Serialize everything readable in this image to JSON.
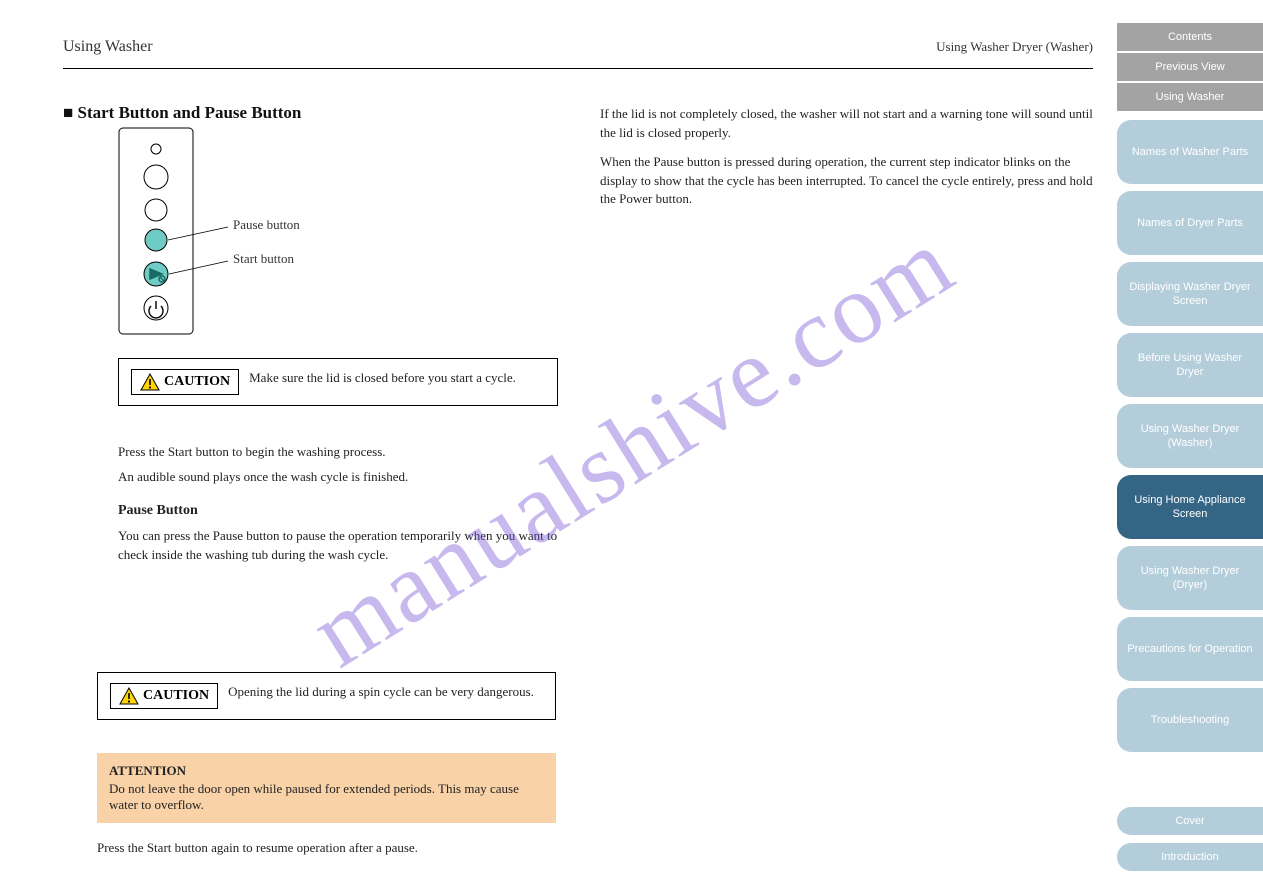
{
  "header": {
    "left": "Using Washer",
    "right": "Using Washer Dryer (Washer)"
  },
  "section": {
    "heading": "■ Start Button and Pause Button"
  },
  "remote": {
    "labels": {
      "pause": "Pause button",
      "start": "Start button"
    }
  },
  "caution1": "Make sure the lid is closed before you start a cycle.",
  "afterCaution1": {
    "p1": "Press the Start button to begin the washing process.",
    "p2": "An audible sound plays once the wash cycle is finished.",
    "h1": "Pause Button",
    "p3": "You can press the Pause button to pause the operation temporarily when you want to check inside the washing tub during the wash cycle."
  },
  "caution2": "Opening the lid during a spin cycle can be very dangerous.",
  "attention": {
    "title": "ATTENTION",
    "body": "Do not leave the door open while paused for extended periods. This may cause water to overflow."
  },
  "finalLine": "Press the Start button again to resume operation after a pause.",
  "rightCol": {
    "p1": "If the lid is not completely closed, the washer will not start and a warning tone will sound until the lid is closed properly.",
    "p2": "When the Pause button is pressed during operation, the current step indicator blinks on the display to show that the cycle has been interrupted. To cancel the cycle entirely, press and hold the Power button."
  },
  "nav": {
    "top": [
      "Contents",
      "Previous View",
      "Using Washer"
    ],
    "sections": [
      {
        "label": "Names of Washer Parts",
        "active": false
      },
      {
        "label": "Names of Dryer Parts",
        "active": false
      },
      {
        "label": "Displaying Washer Dryer Screen",
        "active": false
      },
      {
        "label": "Before Using Washer Dryer",
        "active": false
      },
      {
        "label": "Using Washer Dryer (Washer)",
        "active": false
      },
      {
        "label": "Using Home Appliance Screen",
        "active": true
      },
      {
        "label": "Using Washer Dryer (Dryer)",
        "active": false
      },
      {
        "label": "Precautions for Operation",
        "active": false
      },
      {
        "label": "Troubleshooting",
        "active": false
      }
    ],
    "bottom": [
      "Cover",
      "Introduction"
    ]
  },
  "watermark": "manualshive.com",
  "icons": {
    "caution": "caution-triangle-icon"
  }
}
